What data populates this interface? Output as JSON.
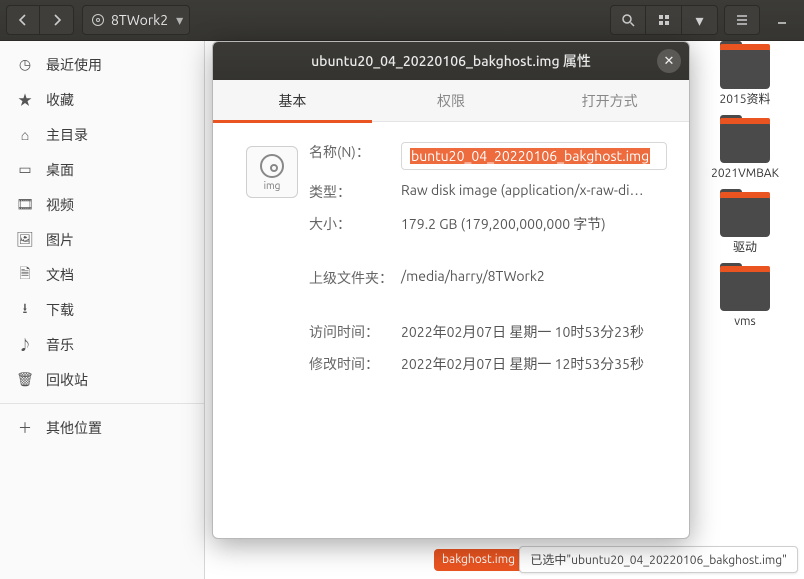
{
  "header": {
    "path_label": "8TWork2"
  },
  "sidebar": {
    "items": [
      {
        "label": "最近使用"
      },
      {
        "label": "收藏"
      },
      {
        "label": "主目录"
      },
      {
        "label": "桌面"
      },
      {
        "label": "视频"
      },
      {
        "label": "图片"
      },
      {
        "label": "文档"
      },
      {
        "label": "下载"
      },
      {
        "label": "音乐"
      },
      {
        "label": "回收站"
      }
    ],
    "other": "其他位置"
  },
  "folders": [
    {
      "label": "2015资料"
    },
    {
      "label": "2021VMBAK"
    },
    {
      "label": "驱动"
    },
    {
      "label": "vms"
    }
  ],
  "selected_file_badge": "bakghost.img",
  "statusbar": "已选中\"ubuntu20_04_20220106_bakghost.img\"",
  "dialog": {
    "title": "ubuntu20_04_20220106_bakghost.img 属性",
    "tabs": [
      {
        "label": "基本",
        "active": true
      },
      {
        "label": "权限",
        "active": false
      },
      {
        "label": "打开方式",
        "active": false
      }
    ],
    "icon_caption": "img",
    "fields": {
      "name_label": "名称(N)：",
      "name_value": "buntu20_04_20220106_bakghost.img",
      "type_label": "类型：",
      "type_value": "Raw disk image (application/x-raw-di…",
      "size_label": "大小：",
      "size_value": "179.2 GB (179,200,000,000 字节)",
      "parent_label": "上级文件夹：",
      "parent_value": "/media/harry/8TWork2",
      "access_label": "访问时间：",
      "access_value": "2022年02月07日 星期一 10时53分23秒",
      "mod_label": "修改时间：",
      "mod_value": "2022年02月07日 星期一 12时53分35秒"
    }
  }
}
